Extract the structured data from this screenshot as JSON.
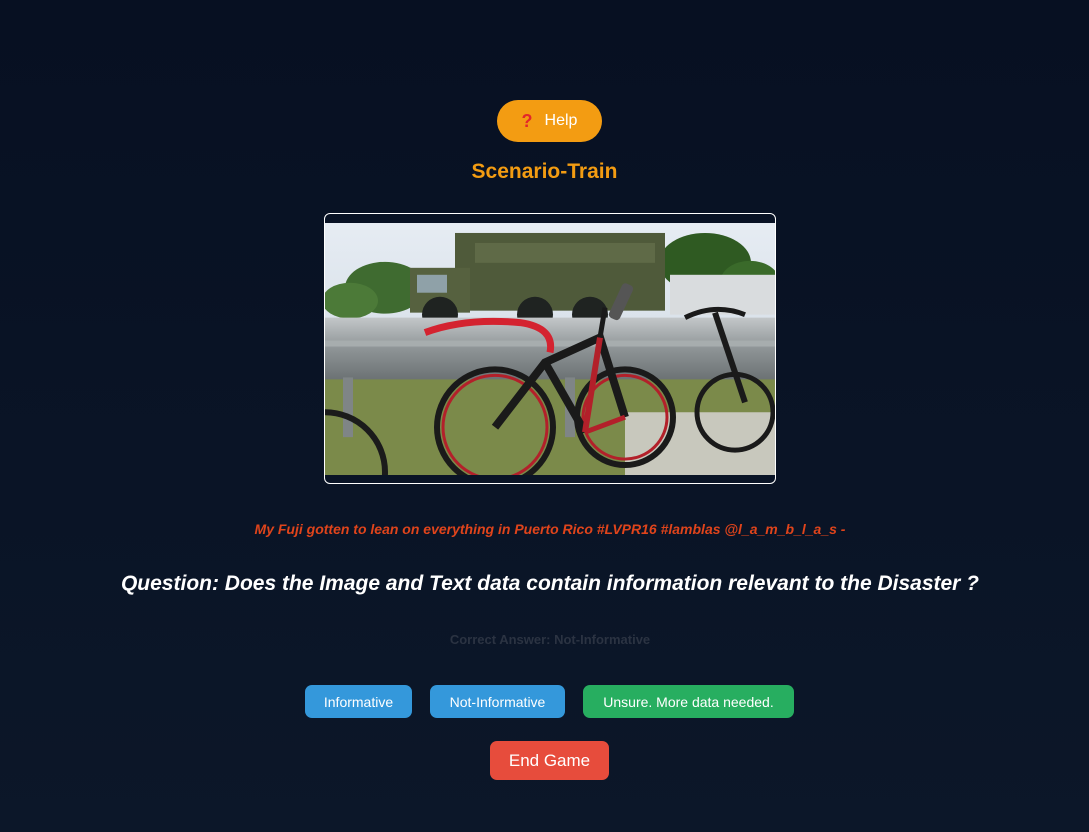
{
  "help": {
    "icon": "question-mark-icon",
    "label": "Help",
    "icon_glyph": "?"
  },
  "title": "Scenario-Train",
  "image": {
    "alt": "Bicycles leaning on a guardrail in front of a military truck"
  },
  "tweet_text": "My Fuji gotten to lean on everything in Puerto Rico #LVPR16 #lamblas @l_a_m_b_l_a_s -",
  "question": "Question: Does the Image and Text data contain information relevant to the Disaster ?",
  "correct_answer": "Correct Answer: Not-Informative",
  "answers": {
    "informative": "Informative",
    "not_informative": "Not-Informative",
    "unsure": "Unsure. More data needed."
  },
  "end_game": "End Game",
  "colors": {
    "background": "#071022",
    "accent": "#f39c12",
    "tweet": "#e0441b",
    "answer_blue": "#3498db",
    "answer_green": "#27ae60",
    "end_red": "#e74c3c"
  }
}
